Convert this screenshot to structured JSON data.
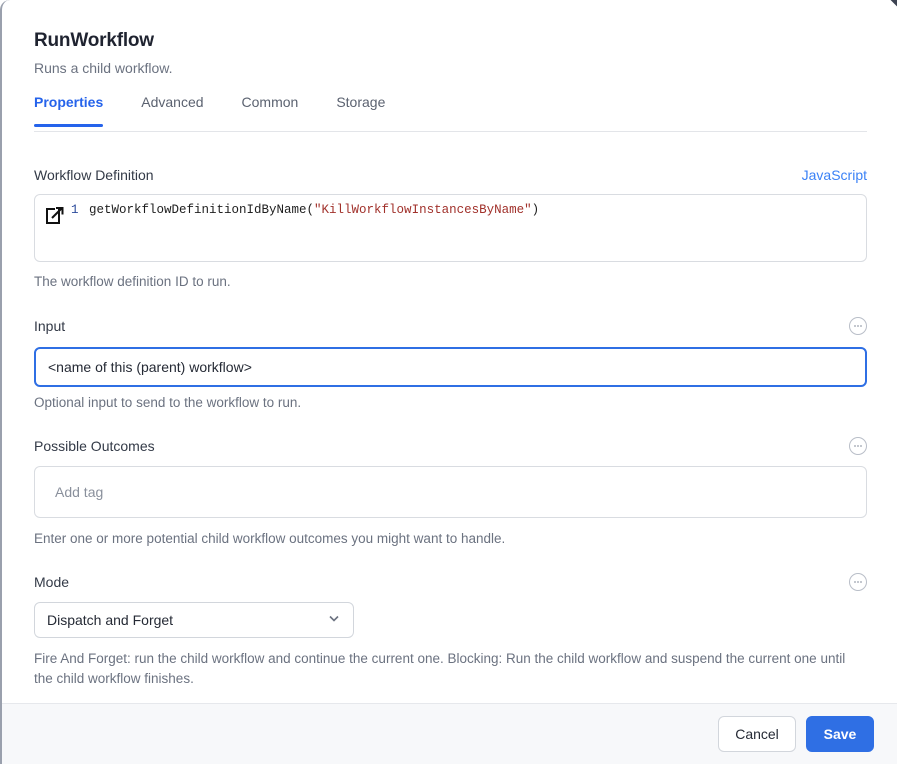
{
  "panel": {
    "title": "RunWorkflow",
    "subtitle": "Runs a child workflow."
  },
  "tabs": [
    {
      "label": "Properties",
      "active": true
    },
    {
      "label": "Advanced",
      "active": false
    },
    {
      "label": "Common",
      "active": false
    },
    {
      "label": "Storage",
      "active": false
    }
  ],
  "fields": {
    "workflow_definition": {
      "label": "Workflow Definition",
      "language": "JavaScript",
      "line_number": "1",
      "code_prefix": "getWorkflowDefinitionIdByName(",
      "code_string": "\"KillWorkflowInstancesByName\"",
      "code_suffix": ")",
      "help": "The workflow definition ID to run.",
      "expand_icon": "external-link-icon"
    },
    "input": {
      "label": "Input",
      "value": "<name of this (parent) workflow>",
      "placeholder": "",
      "help": "Optional input to send to the workflow to run.",
      "options_icon": "ellipsis-circle-icon"
    },
    "possible_outcomes": {
      "label": "Possible Outcomes",
      "placeholder": "Add tag",
      "help": "Enter one or more potential child workflow outcomes you might want to handle.",
      "options_icon": "ellipsis-circle-icon"
    },
    "mode": {
      "label": "Mode",
      "value": "Dispatch and Forget",
      "options": [
        "Dispatch and Forget"
      ],
      "help": "Fire And Forget: run the child workflow and continue the current one. Blocking: Run the child workflow and suspend the current one until the child workflow finishes.",
      "options_icon": "ellipsis-circle-icon",
      "chevron_icon": "chevron-down-icon"
    }
  },
  "footer": {
    "cancel_label": "Cancel",
    "save_label": "Save"
  },
  "colors": {
    "accent": "#2f6fe4",
    "tab_active": "#2563eb",
    "link": "#3b82f6",
    "code_string": "#a1312b",
    "help_text": "#6b7280",
    "footer_bg": "#f7f8fa"
  }
}
